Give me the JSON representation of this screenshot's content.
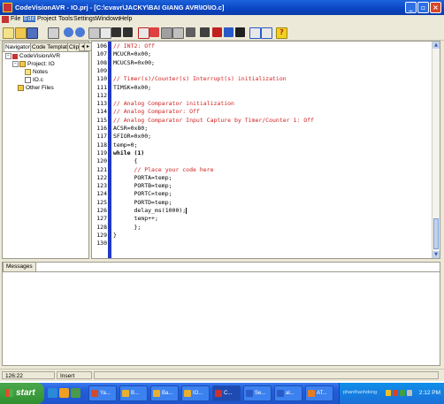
{
  "window": {
    "title": "CodeVisionAVR - IO.prj - [C:\\cvavr\\JACKY\\BAI GIANG AVR\\IO\\IO.c]",
    "controls": [
      "_",
      "▫",
      "×"
    ]
  },
  "menubar": {
    "items": [
      "File",
      "Edit",
      "Project",
      "Tools",
      "Settings",
      "Windows",
      "Help"
    ],
    "active": "Edit"
  },
  "toolbar": {
    "icons": [
      "new-file-icon",
      "open-icon",
      "save-icon",
      "print-icon",
      "undo-icon",
      "redo-icon",
      "cut-icon",
      "copy-icon",
      "paste-icon",
      "find-icon",
      "replace-icon",
      "bookmark-icon",
      "indent-icon",
      "compile-icon",
      "make-icon",
      "chip-icon",
      "debug-icon",
      "programmer-icon",
      "terminal-icon",
      "wizard-icon",
      "project-icon",
      "help-icon"
    ]
  },
  "navigator": {
    "tabs": [
      "Navigator",
      "Code Templates",
      "Clip"
    ],
    "tree": [
      {
        "label": "CodeVisionAVR",
        "level": 0,
        "icon": "cv-logo-icon"
      },
      {
        "label": "Project: IO",
        "level": 1,
        "icon": "folder-icon"
      },
      {
        "label": "Notes",
        "level": 2,
        "icon": "notes-icon"
      },
      {
        "label": "IO.c",
        "level": 2,
        "icon": "c-file-icon"
      },
      {
        "label": "Other Files",
        "level": 1,
        "icon": "folder-icon"
      }
    ]
  },
  "editor": {
    "lines": [
      {
        "n": "106",
        "t": "// INT2: Off",
        "c": "cm"
      },
      {
        "n": "107",
        "t": "MCUCR=0x00;",
        "c": ""
      },
      {
        "n": "108",
        "t": "MCUCSR=0x00;",
        "c": ""
      },
      {
        "n": "109",
        "t": "",
        "c": ""
      },
      {
        "n": "110",
        "t": "// Timer(s)/Counter(s) Interrupt(s) initialization",
        "c": "cm"
      },
      {
        "n": "111",
        "t": "TIMSK=0x00;",
        "c": ""
      },
      {
        "n": "112",
        "t": "",
        "c": ""
      },
      {
        "n": "113",
        "t": "// Analog Comparator initialization",
        "c": "cm"
      },
      {
        "n": "114",
        "t": "// Analog Comparator: Off",
        "c": "cm"
      },
      {
        "n": "115",
        "t": "// Analog Comparator Input Capture by Timer/Counter 1: Off",
        "c": "cm"
      },
      {
        "n": "116",
        "t": "ACSR=0x80;",
        "c": ""
      },
      {
        "n": "117",
        "t": "SFIOR=0x00;",
        "c": ""
      },
      {
        "n": "118",
        "t": "temp=0;",
        "c": ""
      },
      {
        "n": "119",
        "t": "while (1)",
        "c": "kw"
      },
      {
        "n": "120",
        "t": "      {",
        "c": ""
      },
      {
        "n": "121",
        "t": "      // Place your code here",
        "c": "cm"
      },
      {
        "n": "122",
        "t": "      PORTA=temp;",
        "c": ""
      },
      {
        "n": "123",
        "t": "      PORTB=temp;",
        "c": ""
      },
      {
        "n": "124",
        "t": "      PORTC=temp;",
        "c": ""
      },
      {
        "n": "125",
        "t": "      PORTD=temp;",
        "c": ""
      },
      {
        "n": "126",
        "t": "      delay_ms(1000);",
        "c": "cur"
      },
      {
        "n": "127",
        "t": "      temp++;",
        "c": ""
      },
      {
        "n": "128",
        "t": "      };",
        "c": ""
      },
      {
        "n": "129",
        "t": "}",
        "c": ""
      },
      {
        "n": "130",
        "t": "",
        "c": ""
      }
    ]
  },
  "messages": {
    "tab": "Messages"
  },
  "statusbar": {
    "position": "126:22",
    "mode": "Insert"
  },
  "taskbar": {
    "start_label": "start",
    "tasks": [
      {
        "label": "Ya...",
        "color": "#d24a2a"
      },
      {
        "label": "B...",
        "color": "#e8b030"
      },
      {
        "label": "Ba...",
        "color": "#e8b030"
      },
      {
        "label": "IO...",
        "color": "#e8b030"
      },
      {
        "label": "C...",
        "color": "#c83232",
        "active": true
      },
      {
        "label": "Se...",
        "color": "#2a5ac8"
      },
      {
        "label": "al...",
        "color": "#2a5ac8"
      },
      {
        "label": "AT...",
        "color": "#e87a20"
      }
    ],
    "tray_user": "phanthanhdong",
    "clock": "2:12 PM"
  }
}
